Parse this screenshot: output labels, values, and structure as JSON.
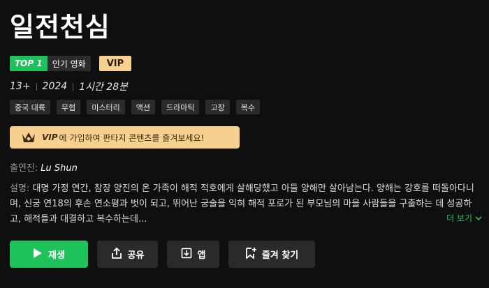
{
  "title": "일전천심",
  "badges": {
    "top": "TOP 1",
    "category": "인기 영화",
    "vip": "VIP"
  },
  "meta": {
    "rating": "13+",
    "year": "2024",
    "duration": "1시간 28분"
  },
  "tags": [
    "중국 대륙",
    "무협",
    "미스터리",
    "액션",
    "드라마틱",
    "고장",
    "복수"
  ],
  "vip_banner": {
    "vip_word": "VIP",
    "text": "에 가입하여 판타지 콘텐츠를 즐겨보세요!"
  },
  "cast": {
    "label": "출연진:",
    "name": "Lu Shun"
  },
  "description": {
    "label": "설명:",
    "text": "대명 가정 연간, 참장 양진의 온 가족이 해적 적호에게 살해당했고 아들 양해만 살아남는다. 양해는 강호를 떠돌아다니며, 신궁 연18의 후손 연소평과 벗이 되고, 뛰어난 궁술을 익혀 해적 포로가 된 부모님의 마을 사람들을 구출하는 데 성공하고, 해적들과 대결하고 복수하는데..."
  },
  "more_label": "더 보기",
  "actions": {
    "play": "재생",
    "share": "공유",
    "app": "앱",
    "favorite": "즐겨 찾기"
  },
  "colors": {
    "accent": "#1fc25a",
    "vip": "#f6d08f",
    "background": "#0f0f10"
  }
}
